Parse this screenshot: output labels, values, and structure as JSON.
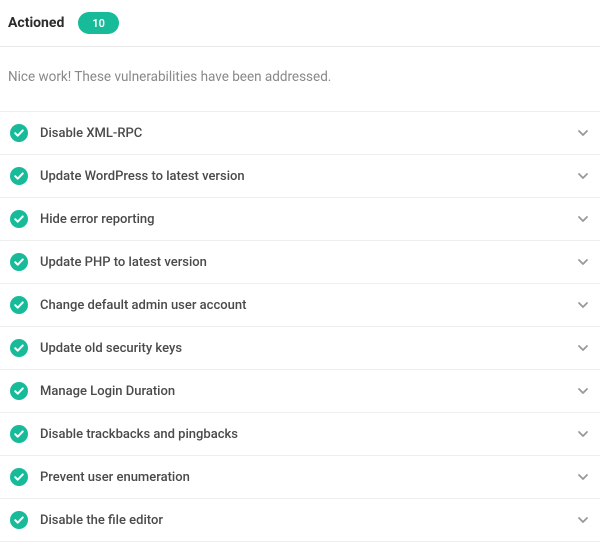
{
  "header": {
    "title": "Actioned",
    "count": "10"
  },
  "intro": "Nice work! These vulnerabilities have been addressed.",
  "items": [
    {
      "label": "Disable XML-RPC"
    },
    {
      "label": "Update WordPress to latest version"
    },
    {
      "label": "Hide error reporting"
    },
    {
      "label": "Update PHP to latest version"
    },
    {
      "label": "Change default admin user account"
    },
    {
      "label": "Update old security keys"
    },
    {
      "label": "Manage Login Duration"
    },
    {
      "label": "Disable trackbacks and pingbacks"
    },
    {
      "label": "Prevent user enumeration"
    },
    {
      "label": "Disable the file editor"
    }
  ],
  "colors": {
    "accent": "#18bb99"
  }
}
